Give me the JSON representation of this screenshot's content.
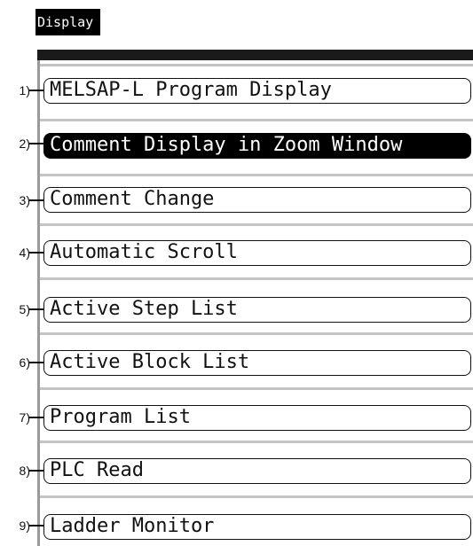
{
  "window": {
    "title": "Display"
  },
  "menu": {
    "items": [
      {
        "callout": "1)",
        "label": "MELSAP-L Program Display",
        "selected": false
      },
      {
        "callout": "2)",
        "label": "Comment Display in Zoom Window",
        "selected": true
      },
      {
        "callout": "3)",
        "label": "Comment Change",
        "selected": false
      },
      {
        "callout": "4)",
        "label": "Automatic Scroll",
        "selected": false
      },
      {
        "callout": "5)",
        "label": "Active Step List",
        "selected": false
      },
      {
        "callout": "6)",
        "label": "Active Block List",
        "selected": false
      },
      {
        "callout": "7)",
        "label": "Program List",
        "selected": false
      },
      {
        "callout": "8)",
        "label": "PLC Read",
        "selected": false
      },
      {
        "callout": "9)",
        "label": "Ladder Monitor",
        "selected": false
      }
    ]
  },
  "colors": {
    "selected_background": "#000000",
    "selected_text": "#ffffff",
    "item_border": "#111111",
    "separator": "#c4c4c4"
  }
}
